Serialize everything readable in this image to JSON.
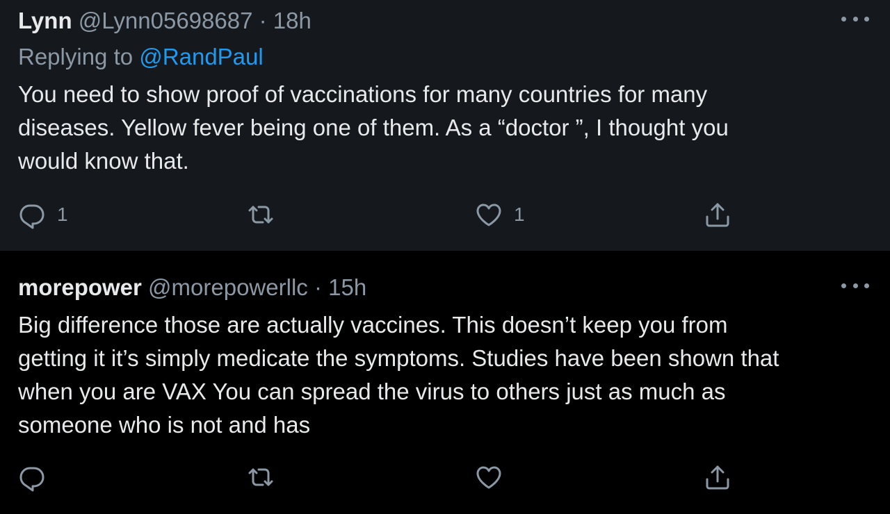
{
  "tweets": [
    {
      "name": "Lynn",
      "handle": "@Lynn05698687",
      "separator": "·",
      "time": "18h",
      "reply_prefix": "Replying to",
      "reply_handle": "@RandPaul",
      "text_lines": [
        "You need to show proof of vaccinations for many countries for many",
        "diseases. Yellow fever being one of them. As a “doctor ”, I thought you",
        "would know that."
      ],
      "reply_count": "1",
      "retweet_count": "",
      "like_count": "1"
    },
    {
      "name": "morepower",
      "handle": "@morepowerllc",
      "separator": "·",
      "time": "15h",
      "text_lines": [
        "Big difference those are actually vaccines. This doesn’t keep you from",
        "getting it it’s simply medicate the symptoms. Studies have been shown that",
        "when you are VAX You can spread the virus to others just as much as",
        "someone who is not and has"
      ],
      "reply_count": "",
      "retweet_count": "",
      "like_count": ""
    }
  ],
  "icons": {
    "reply": "reply-icon",
    "retweet": "retweet-icon",
    "like": "like-icon",
    "share": "share-icon",
    "more": "more-icon"
  },
  "colors": {
    "background_top": "#15181c",
    "background_bottom": "#000000",
    "text": "#e7e9ea",
    "muted": "#8b98a5",
    "link": "#1d9bf0"
  }
}
